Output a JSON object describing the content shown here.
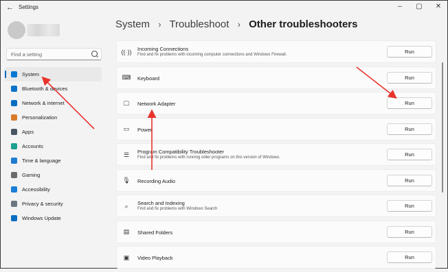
{
  "window": {
    "title": "Settings",
    "back_icon": "arrow-left-icon"
  },
  "sidebar": {
    "search_placeholder": "Find a setting",
    "items": [
      {
        "label": "System",
        "icon": "monitor-icon",
        "color": "#0078d4",
        "active": true
      },
      {
        "label": "Bluetooth & devices",
        "icon": "bluetooth-icon",
        "color": "#0a72c9"
      },
      {
        "label": "Network & internet",
        "icon": "wifi-icon",
        "color": "#0a6ec2"
      },
      {
        "label": "Personalization",
        "icon": "brush-icon",
        "color": "#d97a2b"
      },
      {
        "label": "Apps",
        "icon": "apps-icon",
        "color": "#4a5563"
      },
      {
        "label": "Accounts",
        "icon": "person-icon",
        "color": "#1aa090"
      },
      {
        "label": "Time & language",
        "icon": "globe-icon",
        "color": "#1f7bd0"
      },
      {
        "label": "Gaming",
        "icon": "gamepad-icon",
        "color": "#6b6b6b"
      },
      {
        "label": "Accessibility",
        "icon": "accessibility-icon",
        "color": "#1a7fd6"
      },
      {
        "label": "Privacy & security",
        "icon": "shield-icon",
        "color": "#6b7680"
      },
      {
        "label": "Windows Update",
        "icon": "update-icon",
        "color": "#0a6ec2"
      }
    ]
  },
  "breadcrumb": {
    "part1": "System",
    "part2": "Troubleshoot",
    "current": "Other troubleshooters",
    "separator": "›"
  },
  "troubleshooters": [
    {
      "name": "Incoming Connections",
      "desc": "Find and fix problems with incoming computer connections and Windows Firewall.",
      "icon": "signal-icon",
      "button": "Run"
    },
    {
      "name": "Keyboard",
      "desc": "",
      "icon": "keyboard-icon",
      "button": "Run"
    },
    {
      "name": "Network Adapter",
      "desc": "",
      "icon": "network-adapter-icon",
      "button": "Run"
    },
    {
      "name": "Power",
      "desc": "",
      "icon": "battery-icon",
      "button": "Run"
    },
    {
      "name": "Program Compatibility Troubleshooter",
      "desc": "Find and fix problems with running older programs on this version of Windows.",
      "icon": "list-icon",
      "button": "Run"
    },
    {
      "name": "Recording Audio",
      "desc": "",
      "icon": "microphone-icon",
      "button": "Run"
    },
    {
      "name": "Search and Indexing",
      "desc": "Find and fix problems with Windows Search",
      "icon": "search-icon",
      "button": "Run"
    },
    {
      "name": "Shared Folders",
      "desc": "",
      "icon": "folder-icon",
      "button": "Run"
    },
    {
      "name": "Video Playback",
      "desc": "",
      "icon": "video-icon",
      "button": "Run"
    }
  ],
  "annotations": {
    "arrow_color": "#e8332b"
  }
}
